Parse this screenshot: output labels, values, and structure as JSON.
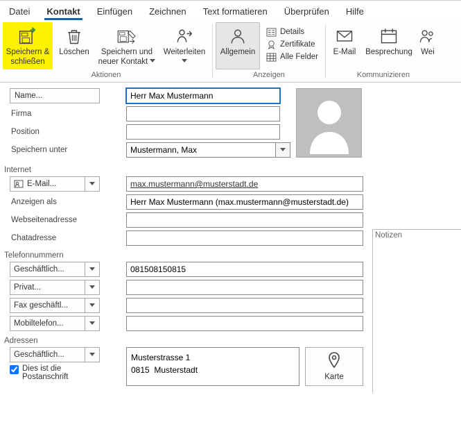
{
  "menu": {
    "tabs": [
      "Datei",
      "Kontakt",
      "Einfügen",
      "Zeichnen",
      "Text formatieren",
      "Überprüfen",
      "Hilfe"
    ],
    "active_index": 1
  },
  "ribbon": {
    "groups": {
      "aktionen": {
        "label": "Aktionen",
        "save_close": "Speichern & schließen",
        "delete": "Löschen",
        "save_new": "Speichern und neuer Kontakt",
        "forward": "Weiterleiten"
      },
      "anzeigen": {
        "label": "Anzeigen",
        "general": "Allgemein",
        "details": "Details",
        "certs": "Zertifikate",
        "allfields": "Alle Felder"
      },
      "komm": {
        "label": "Kommunizieren",
        "email": "E-Mail",
        "meeting": "Besprechung",
        "more": "Wei"
      }
    }
  },
  "form": {
    "name_btn": "Name...",
    "name_val": "Herr Max Mustermann",
    "firma_lbl": "Firma",
    "firma_val": "",
    "position_lbl": "Position",
    "position_val": "",
    "speichern_lbl": "Speichern unter",
    "speichern_val": "Mustermann, Max"
  },
  "sections": {
    "internet": "Internet",
    "tel": "Telefonnummern",
    "addr": "Adressen"
  },
  "internet": {
    "email_btn": "E-Mail...",
    "email_val": "max.mustermann@musterstadt.de",
    "anzeigen_lbl": "Anzeigen als",
    "anzeigen_val": "Herr Max Mustermann (max.mustermann@musterstadt.de)",
    "web_lbl": "Webseitenadresse",
    "web_val": "",
    "chat_lbl": "Chatadresse",
    "chat_val": ""
  },
  "tel": {
    "biz_btn": "Geschäftlich...",
    "biz_val": "081508150815",
    "priv_btn": "Privat...",
    "priv_val": "",
    "fax_btn": "Fax geschäftl...",
    "fax_val": "",
    "mobil_btn": "Mobiltelefon...",
    "mobil_val": ""
  },
  "addr": {
    "biz_btn": "Geschäftlich...",
    "addr_val": "Musterstrasse 1\n0815  Musterstadt",
    "postal_chk": "Dies ist die Postanschrift",
    "map_btn": "Karte"
  },
  "notes": {
    "label": "Notizen"
  }
}
